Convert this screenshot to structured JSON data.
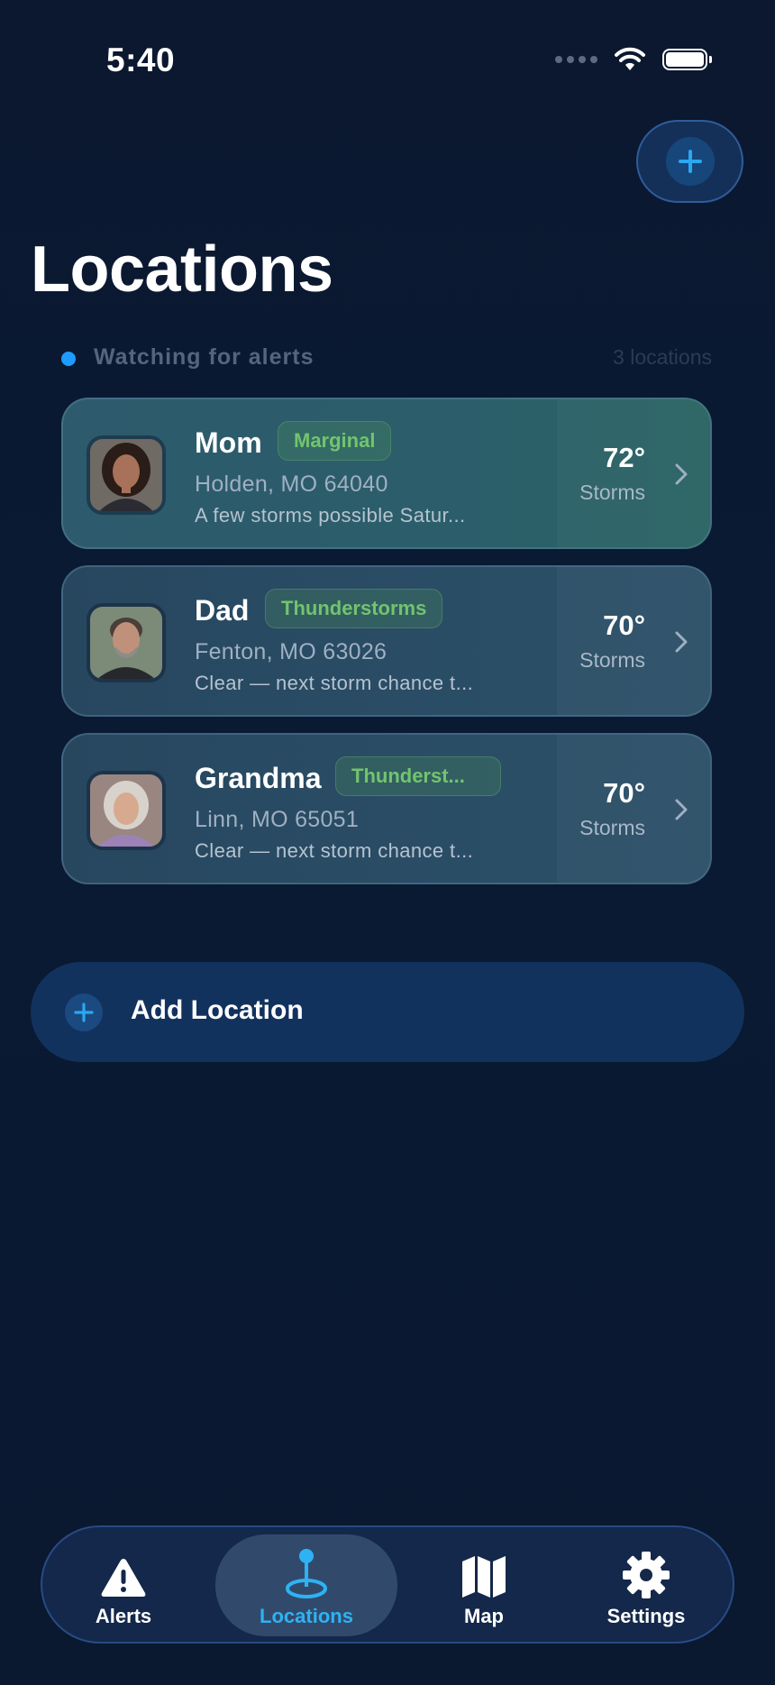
{
  "status_bar": {
    "time": "5:40"
  },
  "header": {
    "title": "Locations"
  },
  "watch": {
    "text": "Watching for alerts",
    "count": "3 locations"
  },
  "locations": [
    {
      "name": "Mom",
      "badge": "Marginal",
      "address": "Holden, MO 64040",
      "forecast": "A few storms possible Satur...",
      "temp": "72°",
      "condition": "Storms"
    },
    {
      "name": "Dad",
      "badge": "Thunderstorms",
      "address": "Fenton, MO 63026",
      "forecast": "Clear — next storm chance t...",
      "temp": "70°",
      "condition": "Storms"
    },
    {
      "name": "Grandma",
      "badge": "Thunderst...",
      "address": "Linn, MO 65051",
      "forecast": "Clear — next storm chance t...",
      "temp": "70°",
      "condition": "Storms"
    }
  ],
  "add_location": {
    "label": "Add Location"
  },
  "tabs": [
    {
      "label": "Alerts",
      "icon": "warning-icon"
    },
    {
      "label": "Locations",
      "icon": "location-pin-icon",
      "active": true
    },
    {
      "label": "Map",
      "icon": "map-icon"
    },
    {
      "label": "Settings",
      "icon": "gear-icon"
    }
  ],
  "colors": {
    "accent": "#2db3f3",
    "badge_green": "#72c46e",
    "background": "#0a1a33"
  }
}
